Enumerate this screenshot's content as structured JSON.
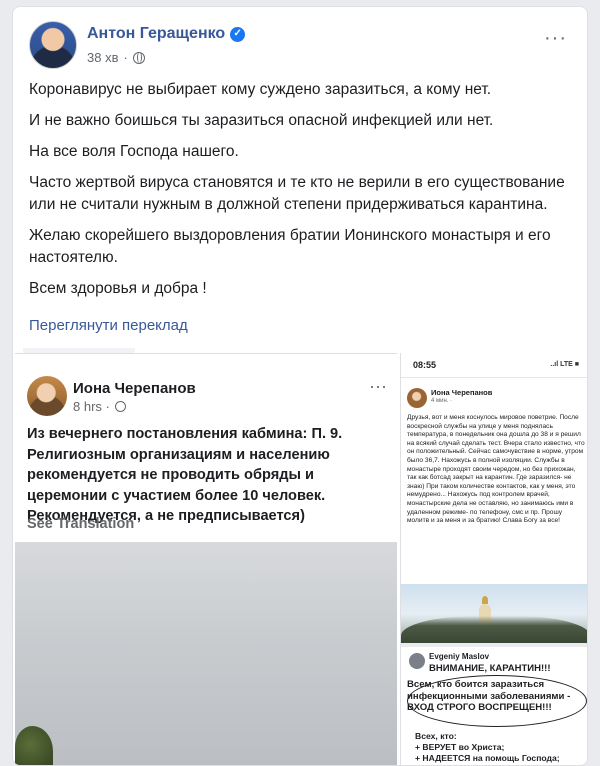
{
  "post": {
    "author": "Антон Геращенко",
    "time": "38 хв",
    "paragraphs": [
      "Коронавирус не выбирает кому суждено заразиться, а кому нет.",
      "И не важно боишься ты заразиться опасной инфекцией или нет.",
      "На все воля Господа нашего.",
      "Часто жертвой вируса становятся и те кто не верили в его существование или не считали нужным в должной степени придерживаться карантина.",
      "Желаю скорейшего выздоровления братии Ионинского монастыря и его настоятелю.",
      "Всем здоровья и добра !"
    ],
    "see_translation": "Переглянути переклад"
  },
  "shared_left": {
    "author": "Иона Черепанов",
    "time": "8 hrs ·",
    "text": "Из вечернего постановления кабмина: П. 9. Религиозным организациям и населению рекомендуется не проводить обряды и церемонии с участием более 10 человек. Рекомендуется, а не предписывается)",
    "see_translation": "See Translation"
  },
  "shared_phone": {
    "status_time": "08:55",
    "status_icons": "..ıl LTE ■",
    "author": "Иона Черепанов",
    "time": "4 мин. ·",
    "text": "Друзья, вот и меня коснулось мировое поветрие. После воскресной службы на улице у меня поднялась температура, в понедельник она дошла до 38 и я решил на всякий случай сделать тест. Вчера стало известно, что он положительный. Сейчас самочувствие в норме, утром было 36,7. Нахожусь в полной изоляции. Службы в монастыре проходят своим чередом, но без прихожан, так как ботсад закрыт на карантин. Где заразился- не знаю) При таком количестве контактов, как у меня, это немудрено... Нахожусь под контролем врачей, монастырские дела не оставляю, но занимаюсь ими в удаленном режиме- по телефону, смс и пр. Прошу молитв и за меня и за братию! Слава Богу за все!"
  },
  "shared_bottom": {
    "author": "Evgeniy Maslov",
    "headline": "ВНИМАНИЕ, КАРАНТИН!!!",
    "warning": "Всем, кто боится заразиться инфекционными заболеваниями - ВХОД СТРОГО ВОСПРЕЩЕН!!!",
    "list": "Всех, кто:\n+ ВЕРУЕТ во Христа;\n+ НАДЕЕТСЯ на помощь Господа;"
  }
}
